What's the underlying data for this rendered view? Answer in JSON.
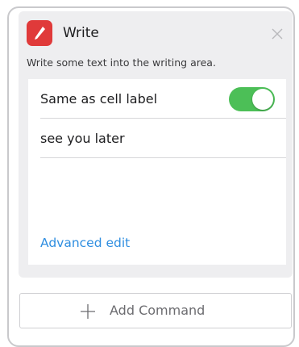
{
  "action": {
    "title": "Write",
    "description": "Write some text into the writing area.",
    "icon": "pencil-icon",
    "icon_color": "#e03a3a"
  },
  "settings": {
    "same_as_label": "Same as cell label",
    "same_as_enabled": true,
    "text_value": "see you later",
    "advanced_label": "Advanced edit"
  },
  "footer": {
    "add_command_label": "Add Command"
  },
  "colors": {
    "toggle_on": "#4cbf57",
    "link": "#2f8ee0"
  }
}
